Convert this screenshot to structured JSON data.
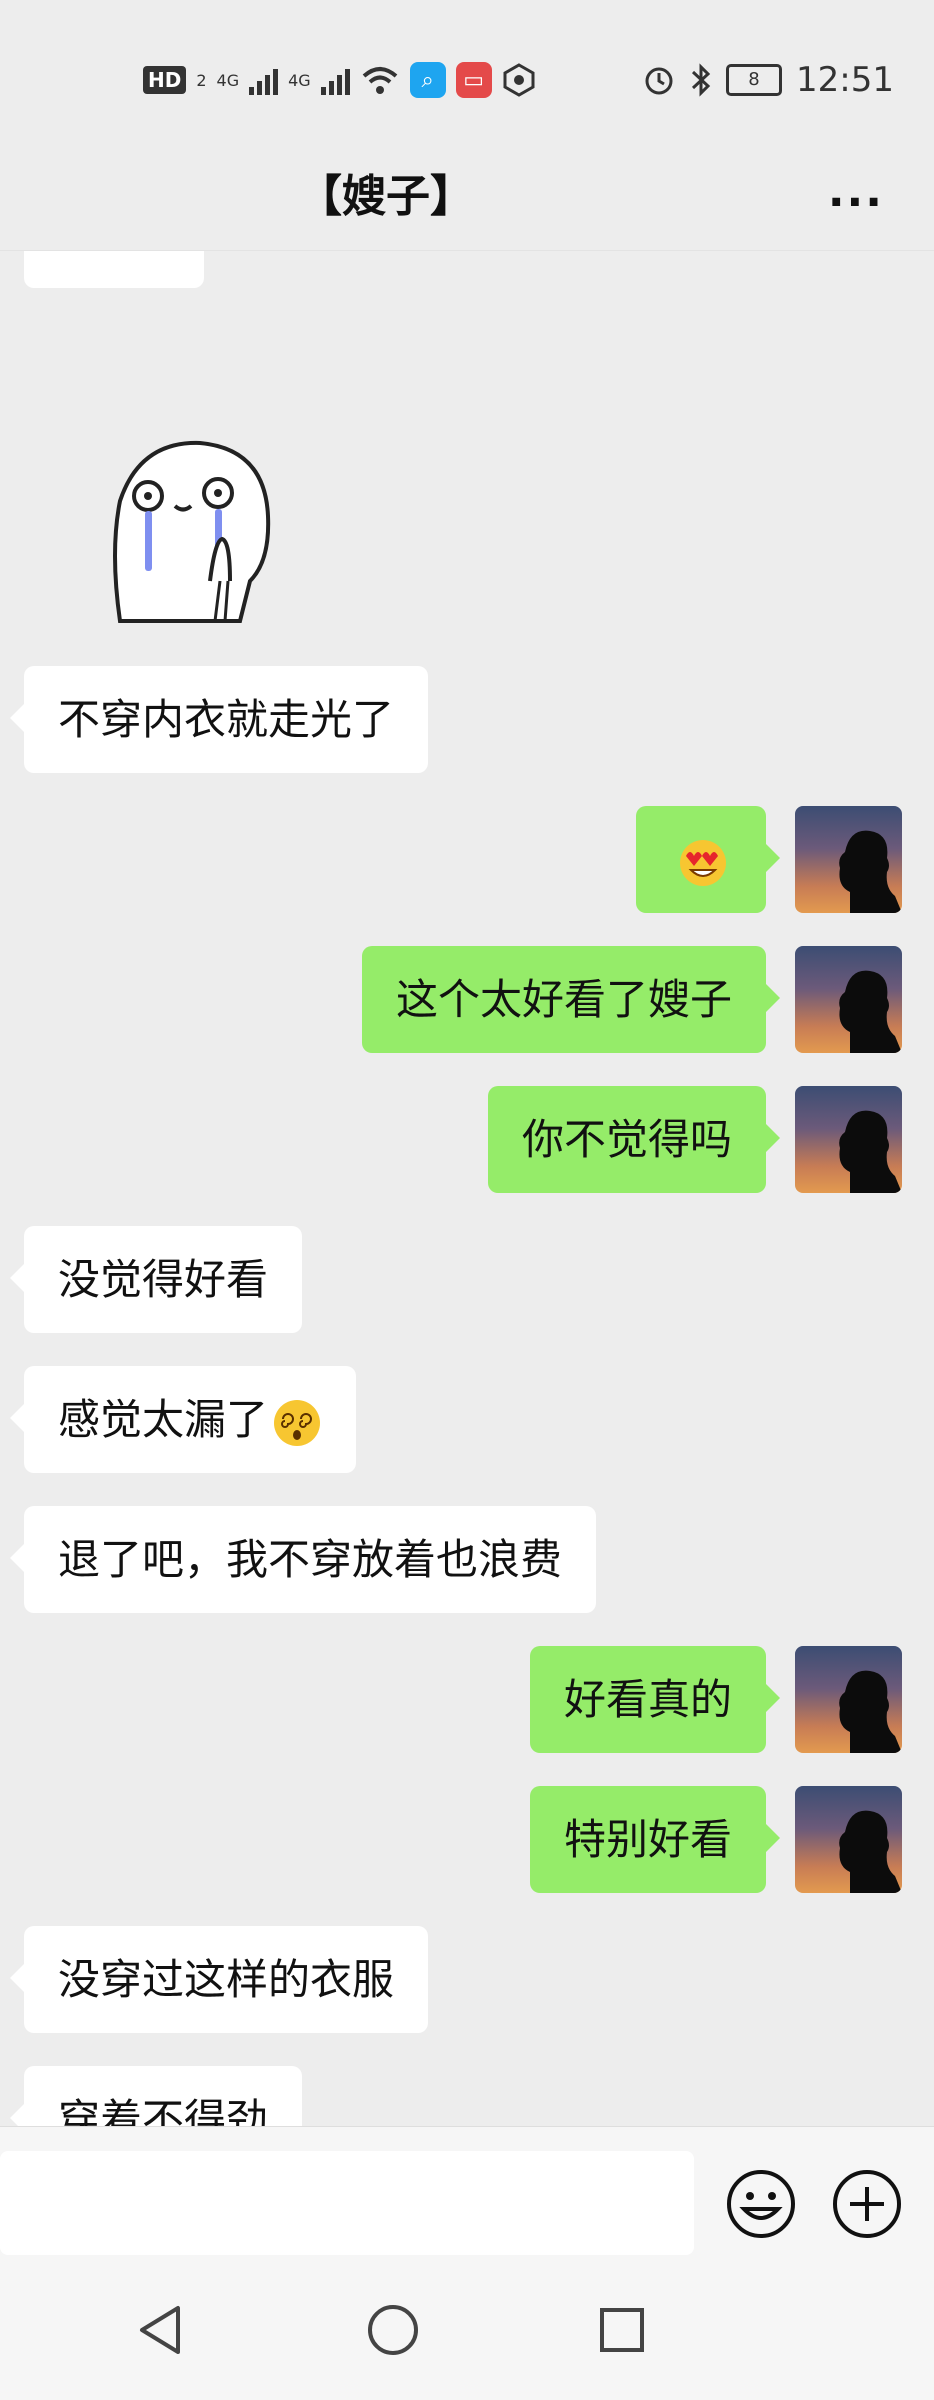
{
  "status_bar": {
    "hd_label": "HD",
    "hd_sub": "2",
    "net1": "4G",
    "net2": "4G",
    "battery": "8",
    "time": "12:51"
  },
  "header": {
    "title": "【嫂子】",
    "more_label": "..."
  },
  "messages": [
    {
      "side": "in",
      "text": "不穿内衣就走光了"
    },
    {
      "side": "out",
      "text": ""
    },
    {
      "side": "out",
      "text": "这个太好看了嫂子"
    },
    {
      "side": "out",
      "text": "你不觉得吗"
    },
    {
      "side": "in",
      "text": "没觉得好看"
    },
    {
      "side": "in",
      "text": "感觉太漏了"
    },
    {
      "side": "in",
      "text": "退了吧，我不穿放着也浪费"
    },
    {
      "side": "out",
      "text": "好看真的"
    },
    {
      "side": "out",
      "text": "特别好看"
    },
    {
      "side": "in",
      "text": "没穿过这样的衣服"
    },
    {
      "side": "in",
      "text": "穿着不得劲"
    }
  ],
  "icons": {
    "emoji_button": "emoji-icon",
    "plus_button": "plus-icon",
    "nav_back": "back-triangle-icon",
    "nav_home": "home-circle-icon",
    "nav_recents": "recents-square-icon"
  },
  "colors": {
    "incoming_bubble": "#ffffff",
    "outgoing_bubble": "#95ec69",
    "chat_background": "#ededed"
  }
}
